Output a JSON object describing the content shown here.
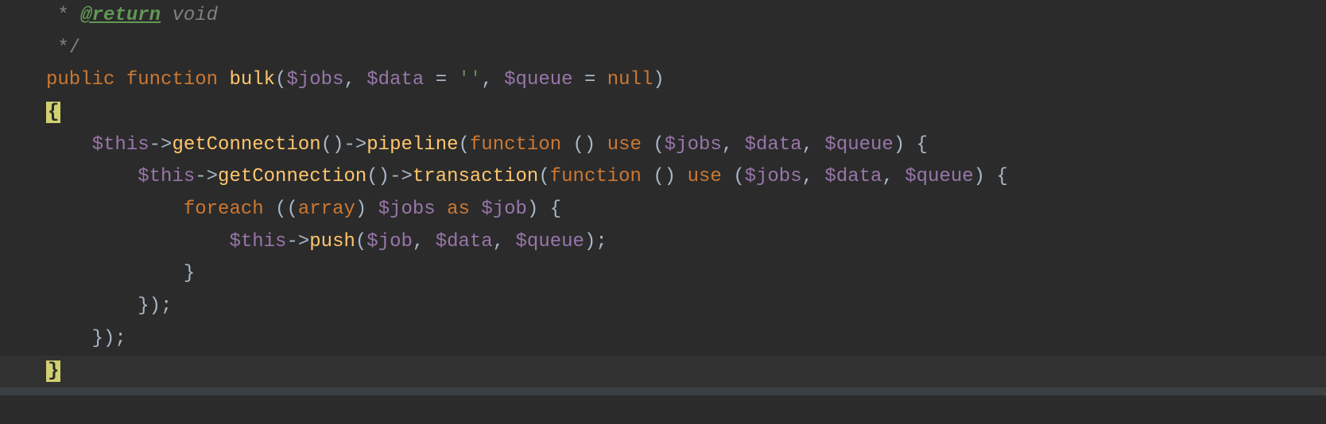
{
  "code": {
    "lines": [
      {
        "tokens": [
          {
            "text": " * ",
            "cls": "c-comment"
          },
          {
            "text": "@return",
            "cls": "c-doc-tag"
          },
          {
            "text": " void",
            "cls": "c-doc-type"
          }
        ]
      },
      {
        "tokens": [
          {
            "text": " */",
            "cls": "c-comment"
          }
        ]
      },
      {
        "tokens": [
          {
            "text": "public function ",
            "cls": "c-keyword"
          },
          {
            "text": "bulk",
            "cls": "c-funcname"
          },
          {
            "text": "(",
            "cls": "c-punct"
          },
          {
            "text": "$jobs",
            "cls": "c-var"
          },
          {
            "text": ", ",
            "cls": "c-punct"
          },
          {
            "text": "$data",
            "cls": "c-var"
          },
          {
            "text": " = ",
            "cls": "c-punct"
          },
          {
            "text": "''",
            "cls": "c-str"
          },
          {
            "text": ", ",
            "cls": "c-punct"
          },
          {
            "text": "$queue",
            "cls": "c-var"
          },
          {
            "text": " = ",
            "cls": "c-punct"
          },
          {
            "text": "null",
            "cls": "c-null"
          },
          {
            "text": ")",
            "cls": "c-punct"
          }
        ]
      },
      {
        "tokens": [
          {
            "text": "{",
            "cls": "brace-open-hl"
          }
        ]
      },
      {
        "tokens": [
          {
            "text": "    ",
            "cls": "c-punct"
          },
          {
            "text": "$this",
            "cls": "c-var"
          },
          {
            "text": "->",
            "cls": "c-punct"
          },
          {
            "text": "getConnection",
            "cls": "c-method"
          },
          {
            "text": "()->",
            "cls": "c-punct"
          },
          {
            "text": "pipeline",
            "cls": "c-method"
          },
          {
            "text": "(",
            "cls": "c-punct"
          },
          {
            "text": "function ",
            "cls": "c-keyword"
          },
          {
            "text": "() ",
            "cls": "c-punct"
          },
          {
            "text": "use ",
            "cls": "c-keyword"
          },
          {
            "text": "(",
            "cls": "c-punct"
          },
          {
            "text": "$jobs",
            "cls": "c-var"
          },
          {
            "text": ", ",
            "cls": "c-punct"
          },
          {
            "text": "$data",
            "cls": "c-var"
          },
          {
            "text": ", ",
            "cls": "c-punct"
          },
          {
            "text": "$queue",
            "cls": "c-var"
          },
          {
            "text": ") {",
            "cls": "c-punct"
          }
        ]
      },
      {
        "tokens": [
          {
            "text": "        ",
            "cls": "c-punct"
          },
          {
            "text": "$this",
            "cls": "c-var"
          },
          {
            "text": "->",
            "cls": "c-punct"
          },
          {
            "text": "getConnection",
            "cls": "c-method"
          },
          {
            "text": "()->",
            "cls": "c-punct"
          },
          {
            "text": "transaction",
            "cls": "c-method"
          },
          {
            "text": "(",
            "cls": "c-punct"
          },
          {
            "text": "function ",
            "cls": "c-keyword"
          },
          {
            "text": "() ",
            "cls": "c-punct"
          },
          {
            "text": "use ",
            "cls": "c-keyword"
          },
          {
            "text": "(",
            "cls": "c-punct"
          },
          {
            "text": "$jobs",
            "cls": "c-var"
          },
          {
            "text": ", ",
            "cls": "c-punct"
          },
          {
            "text": "$data",
            "cls": "c-var"
          },
          {
            "text": ", ",
            "cls": "c-punct"
          },
          {
            "text": "$queue",
            "cls": "c-var"
          },
          {
            "text": ") {",
            "cls": "c-punct"
          }
        ]
      },
      {
        "tokens": [
          {
            "text": "            ",
            "cls": "c-punct"
          },
          {
            "text": "foreach ",
            "cls": "c-keyword"
          },
          {
            "text": "((",
            "cls": "c-punct"
          },
          {
            "text": "array",
            "cls": "c-keyword"
          },
          {
            "text": ") ",
            "cls": "c-punct"
          },
          {
            "text": "$jobs",
            "cls": "c-var"
          },
          {
            "text": " ",
            "cls": "c-punct"
          },
          {
            "text": "as ",
            "cls": "c-keyword"
          },
          {
            "text": "$job",
            "cls": "c-var"
          },
          {
            "text": ") {",
            "cls": "c-punct"
          }
        ]
      },
      {
        "tokens": [
          {
            "text": "                ",
            "cls": "c-punct"
          },
          {
            "text": "$this",
            "cls": "c-var"
          },
          {
            "text": "->",
            "cls": "c-punct"
          },
          {
            "text": "push",
            "cls": "c-method"
          },
          {
            "text": "(",
            "cls": "c-punct"
          },
          {
            "text": "$job",
            "cls": "c-var"
          },
          {
            "text": ", ",
            "cls": "c-punct"
          },
          {
            "text": "$data",
            "cls": "c-var"
          },
          {
            "text": ", ",
            "cls": "c-punct"
          },
          {
            "text": "$queue",
            "cls": "c-var"
          },
          {
            "text": ");",
            "cls": "c-punct"
          }
        ]
      },
      {
        "tokens": [
          {
            "text": "            }",
            "cls": "c-punct"
          }
        ]
      },
      {
        "tokens": [
          {
            "text": "        });",
            "cls": "c-punct"
          }
        ]
      },
      {
        "tokens": [
          {
            "text": "    });",
            "cls": "c-punct"
          }
        ]
      },
      {
        "highlighted": true,
        "tokens": [
          {
            "text": "}",
            "cls": "brace-close-hl"
          }
        ]
      }
    ]
  }
}
